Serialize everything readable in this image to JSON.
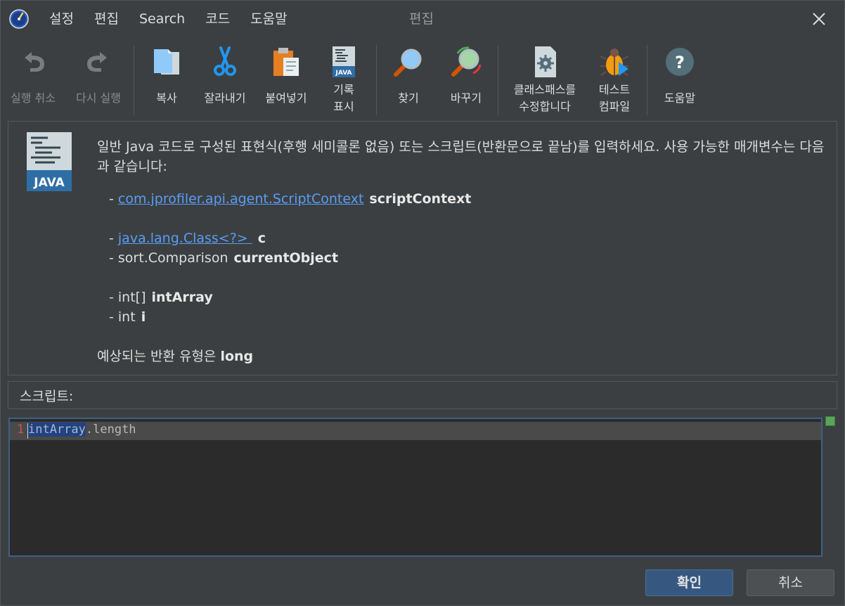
{
  "menu": {
    "items": [
      "설정",
      "편집",
      "Search",
      "코드",
      "도움말"
    ]
  },
  "window_title": "편집",
  "toolbar": {
    "undo": "실행 취소",
    "redo": "다시 실행",
    "copy": "복사",
    "cut": "잘라내기",
    "paste": "붙여넣기",
    "history_line1": "기록",
    "history_line2": "표시",
    "find": "찾기",
    "replace": "바꾸기",
    "classpath_line1": "클래스패스를",
    "classpath_line2": "수정합니다",
    "test_line1": "테스트",
    "test_line2": "컴파일",
    "help": "도움말"
  },
  "description": {
    "intro": "일반 Java 코드로 구성된 표현식(후행 세미콜론 없음) 또는 스크립트(반환문으로 끝남)를 입력하세요. 사용 가능한 매개변수는 다음과 같습니다:",
    "params": [
      {
        "prefix": "- ",
        "type": "com.jprofiler.api.agent.ScriptContext",
        "link": true,
        "name": "scriptContext"
      },
      {
        "prefix": "- ",
        "type": "java.lang.Class<?> ",
        "link": true,
        "name": "c"
      },
      {
        "prefix": "- ",
        "type": "sort.Comparison",
        "link": false,
        "name": "currentObject"
      },
      {
        "prefix": "- ",
        "type": "int[]",
        "link": false,
        "name": "intArray"
      },
      {
        "prefix": "- ",
        "type": "int",
        "link": false,
        "name": "i"
      }
    ],
    "return_prefix": "예상되는 반환 유형은 ",
    "return_type": "long",
    "java_badge": "JAVA"
  },
  "script_label": "스크립트:",
  "editor": {
    "line_number": "1",
    "code_highlighted": "intArray",
    "code_rest": ".length"
  },
  "buttons": {
    "ok": "확인",
    "cancel": "취소"
  },
  "colors": {
    "background": "#3c3f41",
    "link": "#589df6",
    "ok_button": "#365880",
    "editor_border": "#3d6185"
  }
}
